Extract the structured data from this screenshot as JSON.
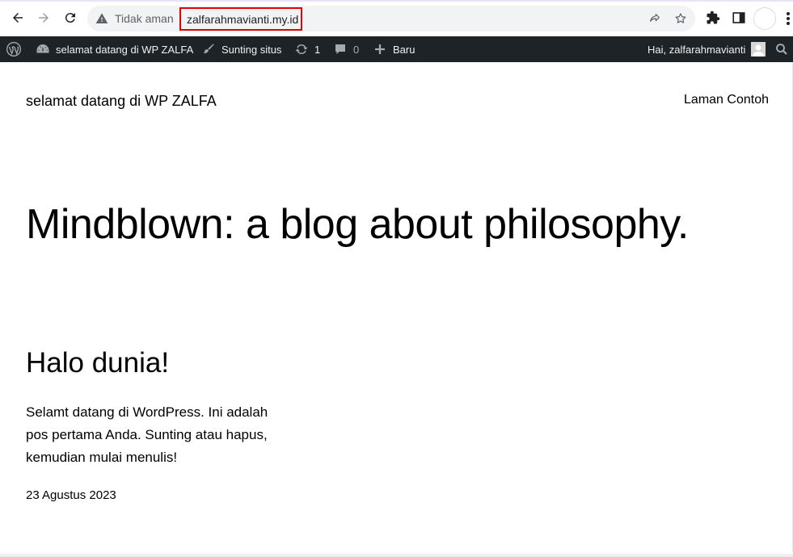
{
  "browser": {
    "not_secure_label": "Tidak aman",
    "url": "zalfarahmavianti.my.id",
    "icons": [
      "back-arrow-icon",
      "forward-arrow-icon",
      "reload-icon",
      "warning-icon",
      "share-icon",
      "star-icon",
      "extensions-icon",
      "side-panel-icon",
      "profile-icon",
      "more-icon"
    ],
    "highlight_color": "#e00000"
  },
  "admin_bar": {
    "site_name": "selamat datang di WP ZALFA",
    "customize_label": "Sunting situs",
    "updates_count": "1",
    "comments_count": "0",
    "new_label": "Baru",
    "greeting": "Hai, zalfarahmavianti",
    "background": "#1d2327"
  },
  "site": {
    "title": "selamat datang di WP ZALFA",
    "nav_item": "Laman Contoh",
    "tagline": "Mindblown: a blog about philosophy."
  },
  "post": {
    "title": "Halo dunia!",
    "excerpt": "Selamt datang di WordPress. Ini adalah pos pertama Anda. Sunting atau hapus, kemudian mulai menulis!",
    "date": "23 Agustus 2023"
  }
}
